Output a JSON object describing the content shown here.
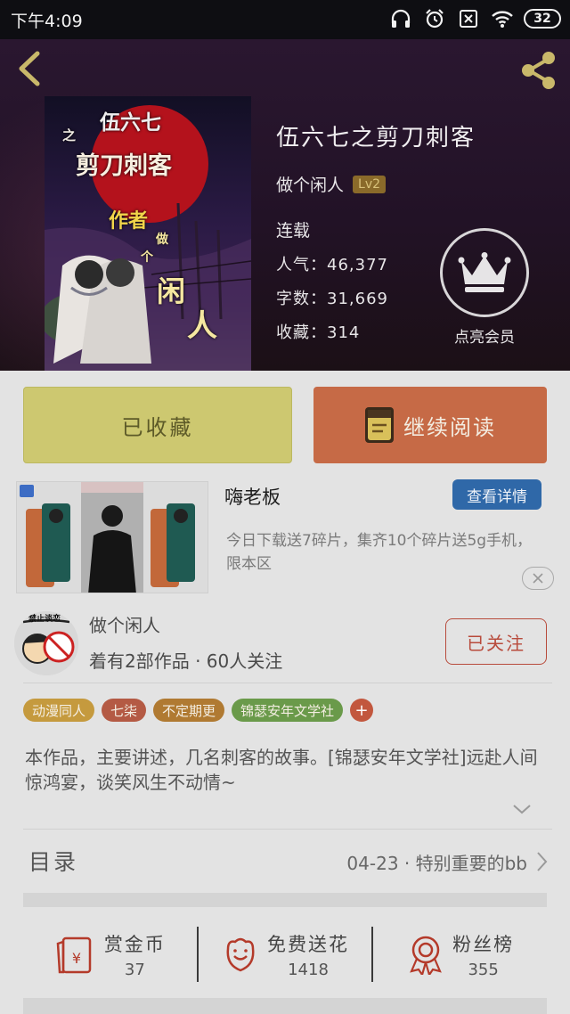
{
  "status_bar": {
    "time": "下午4:09",
    "battery": "32"
  },
  "book": {
    "cover_text": [
      "伍六七",
      "之",
      "剪刀刺客",
      "作者",
      "做",
      "个",
      "闲",
      "人"
    ],
    "title": "伍六七之剪刀刺客",
    "author": "做个闲人",
    "author_level": "Lv2",
    "status": "连载",
    "popularity": "人气：46,377",
    "word_count": "字数：31,669",
    "favorites": "收藏：314"
  },
  "vip": {
    "label": "点亮会员"
  },
  "actions": {
    "favorited": "已收藏",
    "continue_reading": "继续阅读"
  },
  "ad": {
    "title": "嗨老板",
    "detail_button": "查看详情",
    "description": "今日下载送7碎片，集齐10个碎片送5g手机，限本区"
  },
  "author_card": {
    "avatar_text": "禁止谈恋",
    "name": "做个闲人",
    "meta": "着有2部作品 · 60人关注",
    "follow_button": "已关注"
  },
  "tags": [
    {
      "label": "动漫同人",
      "color": "#c59a3e"
    },
    {
      "label": "七柒",
      "color": "#b45a44"
    },
    {
      "label": "不定期更",
      "color": "#b07a32"
    },
    {
      "label": "锦瑟安年文学社",
      "color": "#6a9a4a"
    }
  ],
  "tag_add": "+",
  "description": "本作品，主要讲述，几名刺客的故事。[锦瑟安年文学社]远赴人间惊鸿宴，谈笑风生不动情~",
  "toc": {
    "label": "目录",
    "latest": "04-23 · 特别重要的bb"
  },
  "rewards": [
    {
      "label": "赏金币",
      "value": "37",
      "icon": "red-envelope-icon"
    },
    {
      "label": "免费送花",
      "value": "1418",
      "icon": "flower-icon"
    },
    {
      "label": "粉丝榜",
      "value": "355",
      "icon": "medal-icon"
    }
  ],
  "colors": {
    "fav_button": "#cdc870",
    "read_button": "#c66a46",
    "accent_red": "#b84b3c",
    "detail_blue": "#2f68a8",
    "lv_badge": "#8a6a2a"
  }
}
